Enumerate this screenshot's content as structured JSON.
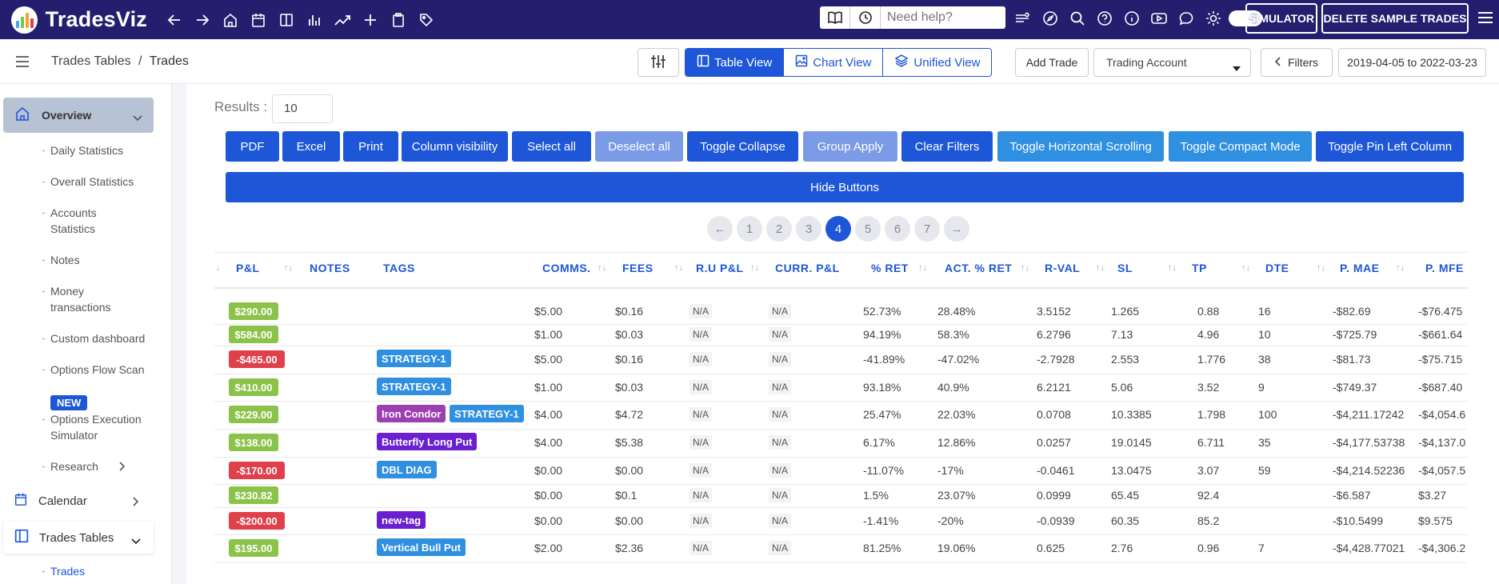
{
  "app": {
    "name": "TradesViz"
  },
  "topbar": {
    "nav_icons": [
      "back-arrow-icon",
      "forward-arrow-icon",
      "home-icon",
      "calendar-icon",
      "columns-icon",
      "bar-chart-icon",
      "trend-icon",
      "plus-icon",
      "clipboard-icon",
      "tag-icon"
    ],
    "help_placeholder": "Need help?",
    "simulator_label": "SIMULATOR",
    "delete_label": "DELETE SAMPLE TRADES"
  },
  "breadcrumb": {
    "parent": "Trades Tables",
    "sep": "/",
    "current": "Trades"
  },
  "views": {
    "table": "Table View",
    "chart": "Chart View",
    "unified": "Unified View"
  },
  "add_trade": "Add Trade",
  "account_select": "Trading Account",
  "filters": "Filters",
  "date_range": "2019-04-05 to 2022-03-23",
  "sidebar": {
    "overview": "Overview",
    "items": [
      "Daily Statistics",
      "Overall Statistics",
      "Accounts\nStatistics",
      "Notes",
      "Money\ntransactions",
      "Custom dashboard",
      "Options Flow Scan"
    ],
    "new_badge": "NEW",
    "sim_item": "Options Execution\nSimulator",
    "research": "Research",
    "calendar": "Calendar",
    "trades_tables": "Trades Tables",
    "trades": "Trades"
  },
  "results": {
    "label": "Results :",
    "value": "10"
  },
  "buttons": [
    "PDF",
    "Excel",
    "Print",
    "Column visibility",
    "Select all",
    "Deselect all",
    "Toggle Collapse",
    "Group Apply",
    "Clear Filters",
    "Toggle Horizontal Scrolling",
    "Toggle Compact Mode",
    "Toggle Pin Left Column"
  ],
  "hide_buttons": "Hide Buttons",
  "pagination": {
    "prev": "←",
    "pages": [
      "1",
      "2",
      "3",
      "4",
      "5",
      "6",
      "7"
    ],
    "current": "4",
    "next": "→"
  },
  "columns": [
    "P&L",
    "NOTES",
    "TAGS",
    "COMMS.",
    "FEES",
    "R.U P&L",
    "CURR. P&L",
    "% RET",
    "ACT. % RET",
    "R-VAL",
    "SL",
    "TP",
    "DTE",
    "P. MAE",
    "P. MFE"
  ],
  "rows": [
    {
      "pnl": "$290.00",
      "pos": true,
      "tags": [],
      "comms": "$5.00",
      "fees": "$0.16",
      "ru": "N/A",
      "curr": "N/A",
      "ret": "52.73%",
      "act": "28.48%",
      "rval": "3.5152",
      "sl": "1.265",
      "tp": "0.88",
      "dte": "16",
      "mae": "-$82.69",
      "mfe": "-$76.475"
    },
    {
      "pnl": "$584.00",
      "pos": true,
      "tags": [],
      "comms": "$1.00",
      "fees": "$0.03",
      "ru": "N/A",
      "curr": "N/A",
      "ret": "94.19%",
      "act": "58.3%",
      "rval": "6.2796",
      "sl": "7.13",
      "tp": "4.96",
      "dte": "10",
      "mae": "-$725.79",
      "mfe": "-$661.64"
    },
    {
      "pnl": "-$465.00",
      "pos": false,
      "tags": [
        "STRATEGY-1"
      ],
      "comms": "$5.00",
      "fees": "$0.16",
      "ru": "N/A",
      "curr": "N/A",
      "ret": "-41.89%",
      "act": "-47.02%",
      "rval": "-2.7928",
      "sl": "2.553",
      "tp": "1.776",
      "dte": "38",
      "mae": "-$81.73",
      "mfe": "-$75.715"
    },
    {
      "pnl": "$410.00",
      "pos": true,
      "tags": [
        "STRATEGY-1"
      ],
      "comms": "$1.00",
      "fees": "$0.03",
      "ru": "N/A",
      "curr": "N/A",
      "ret": "93.18%",
      "act": "40.9%",
      "rval": "6.2121",
      "sl": "5.06",
      "tp": "3.52",
      "dte": "9",
      "mae": "-$749.37",
      "mfe": "-$687.40"
    },
    {
      "pnl": "$229.00",
      "pos": true,
      "tags": [
        "Iron Condor",
        "STRATEGY-1"
      ],
      "comms": "$4.00",
      "fees": "$4.72",
      "ru": "N/A",
      "curr": "N/A",
      "ret": "25.47%",
      "act": "22.03%",
      "rval": "0.0708",
      "sl": "10.3385",
      "tp": "1.798",
      "dte": "100",
      "mae": "-$4,211.17242",
      "mfe": "-$4,054.6"
    },
    {
      "pnl": "$138.00",
      "pos": true,
      "tags": [
        "Butterfly Long Put"
      ],
      "comms": "$4.00",
      "fees": "$5.38",
      "ru": "N/A",
      "curr": "N/A",
      "ret": "6.17%",
      "act": "12.86%",
      "rval": "0.0257",
      "sl": "19.0145",
      "tp": "6.711",
      "dte": "35",
      "mae": "-$4,177.53738",
      "mfe": "-$4,137.0"
    },
    {
      "pnl": "-$170.00",
      "pos": false,
      "tags": [
        "DBL DIAG"
      ],
      "comms": "$0.00",
      "fees": "$0.00",
      "ru": "N/A",
      "curr": "N/A",
      "ret": "-11.07%",
      "act": "-17%",
      "rval": "-0.0461",
      "sl": "13.0475",
      "tp": "3.07",
      "dte": "59",
      "mae": "-$4,214.52236",
      "mfe": "-$4,057.5"
    },
    {
      "pnl": "$230.82",
      "pos": true,
      "tags": [],
      "comms": "$0.00",
      "fees": "$0.1",
      "ru": "N/A",
      "curr": "N/A",
      "ret": "1.5%",
      "act": "23.07%",
      "rval": "0.0999",
      "sl": "65.45",
      "tp": "92.4",
      "dte": "",
      "mae": "-$6.587",
      "mfe": "$3.27"
    },
    {
      "pnl": "-$200.00",
      "pos": false,
      "tags": [
        "new-tag"
      ],
      "comms": "$0.00",
      "fees": "$0.00",
      "ru": "N/A",
      "curr": "N/A",
      "ret": "-1.41%",
      "act": "-20%",
      "rval": "-0.0939",
      "sl": "60.35",
      "tp": "85.2",
      "dte": "",
      "mae": "-$10.5499",
      "mfe": "$9.575"
    },
    {
      "pnl": "$195.00",
      "pos": true,
      "tags": [
        "Vertical Bull Put"
      ],
      "comms": "$2.00",
      "fees": "$2.36",
      "ru": "N/A",
      "curr": "N/A",
      "ret": "81.25%",
      "act": "19.06%",
      "rval": "0.625",
      "sl": "2.76",
      "tp": "0.96",
      "dte": "7",
      "mae": "-$4,428.77021",
      "mfe": "-$4,306.2"
    }
  ],
  "colors": {
    "navbar": "#231e6e",
    "accent": "#1e56d8",
    "light_button": "#2f8fe0",
    "disabled_button": "#7c9be6",
    "positive": "#8bc34a",
    "negative": "#e0404a",
    "tag_strategy": "#2f8fe0",
    "tag_iron_condor": "#9c3fb3",
    "tag_purple": "#6a1fd1"
  }
}
